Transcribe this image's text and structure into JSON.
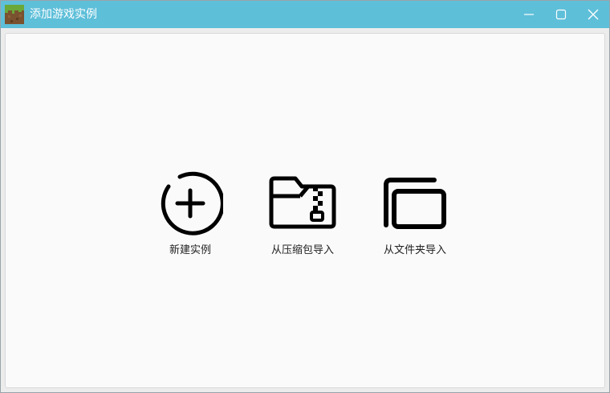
{
  "window": {
    "title": "添加游戏实例",
    "icon": "grass-block-icon",
    "controls": [
      "minimize-icon",
      "maximize-icon",
      "close-icon"
    ]
  },
  "actions": [
    {
      "label": "新建实例",
      "icon": "plus-circle-icon"
    },
    {
      "label": "从压缩包导入",
      "icon": "zip-folder-icon"
    },
    {
      "label": "从文件夹导入",
      "icon": "folder-copy-icon"
    }
  ],
  "colors": {
    "titlebar": "#5ebfd9",
    "title_text": "#ffffff",
    "content_bg": "#fafafa",
    "icon": "#000000"
  }
}
